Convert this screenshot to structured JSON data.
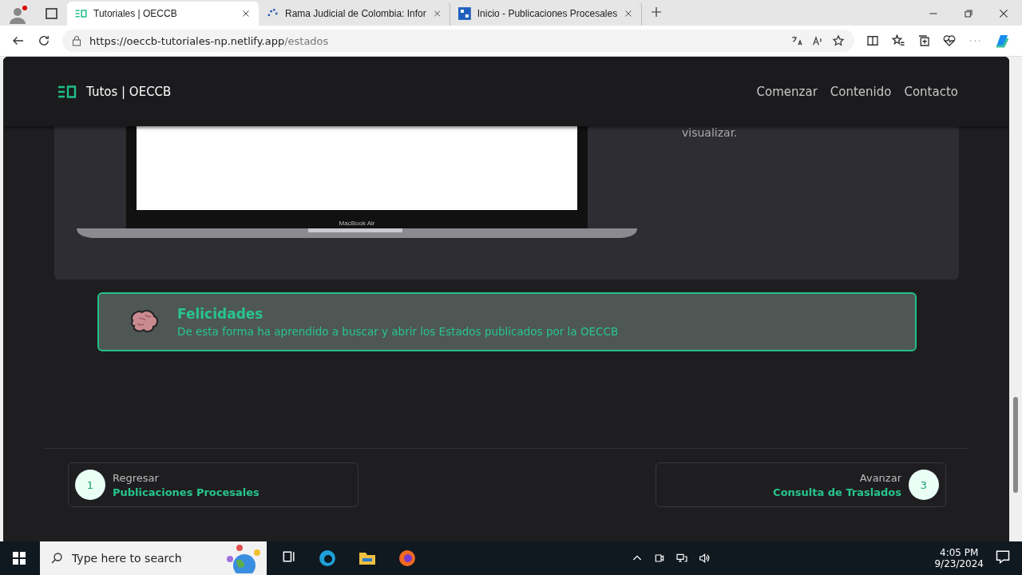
{
  "browser": {
    "tabs": [
      {
        "title": "Tutoriales | OECCB",
        "selected": true,
        "kind": "logo"
      },
      {
        "title": "Rama Judicial de Colombia: Infor",
        "selected": false,
        "kind": "dots"
      },
      {
        "title": "Inicio - Publicaciones Procesales",
        "selected": false,
        "kind": "grid"
      }
    ],
    "url_host": "https://oeccb-tutoriales-np.netlify.app",
    "url_path": "/estados"
  },
  "site": {
    "brand": "Tutos | OECCB",
    "nav": [
      "Comenzar",
      "Contenido",
      "Contacto"
    ]
  },
  "lesson": {
    "device_label": "MacBook Air",
    "side_text": "visualizar."
  },
  "alert": {
    "title": "Felicidades",
    "message": "De esta forma ha aprendido a buscar y abrir los Estados publicados por la OECCB"
  },
  "pager": [
    {
      "step": "1",
      "label": "Regresar",
      "target": "Publicaciones Procesales",
      "kind": "prev"
    },
    {
      "step": "3",
      "label": "Avanzar",
      "target": "Consulta de Traslados",
      "kind": "next"
    }
  ],
  "taskbar": {
    "search_placeholder": "Type here to search",
    "time": "4:05 PM",
    "date": "9/23/2024"
  }
}
